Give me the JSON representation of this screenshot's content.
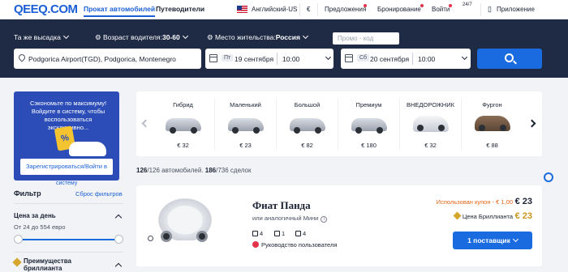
{
  "header": {
    "logo": "QEEQ.COM",
    "tab_active": "Прокат автомобилей",
    "tab_other": "Путеводители",
    "language": "Английский-US",
    "currency": "€",
    "offers": "Предложения",
    "bookings": "Бронирование",
    "login": "Войти",
    "support_label": "24/7",
    "app": "Приложение"
  },
  "search": {
    "same_dropoff": "Та же высадка",
    "driver_age_label": "Возраст водителя:",
    "driver_age_value": "30-60",
    "residence_label": "Место жительства:",
    "residence_value": "Россия",
    "promo_placeholder": "Промо - код",
    "location": "Podgorica Airport(TGD), Podgorica, Montenegro",
    "pickup_day": "Пт",
    "pickup_date": "19 сентября",
    "pickup_time": "10:00",
    "return_day": "Сб",
    "return_date": "20 сентября",
    "return_time": "10:00"
  },
  "promo_card": {
    "text": "Сэкономьте по максимуму! Войдите в систему, чтобы воспользоваться эксклюзивно...",
    "tag": "%",
    "register_button": "Зарегистрироваться/Войти в",
    "register_tail": "систему"
  },
  "categories": [
    {
      "name": "Гибрид",
      "price": "€ 32"
    },
    {
      "name": "Маленький",
      "price": "€ 23"
    },
    {
      "name": "Большой",
      "price": "€ 82"
    },
    {
      "name": "Премиум",
      "price": "€ 180"
    },
    {
      "name": "ВНЕДОРОЖНИК",
      "price": "€ 32"
    },
    {
      "name": "Фургон",
      "price": "€ 88"
    }
  ],
  "counts": {
    "cars_bold": "126",
    "cars_rest": "/126 автомобилей.",
    "deals_bold": "186",
    "deals_rest": "/736 сделок"
  },
  "filters": {
    "title": "Фильтр",
    "reset": "Сброс фильтров",
    "price_title": "Цена за день",
    "price_range": "От 24 до 554 евро",
    "perk_title_1": "Преимущества",
    "perk_title_2": "бриллианта"
  },
  "result": {
    "name": "Фиат Панда",
    "similar": "или аналогичный Мини",
    "seats": "4",
    "bags": "1",
    "doors": "4",
    "guide": "Руководство пользователя",
    "coupon": "Использован купон - € 1,00",
    "price": "€ 23",
    "diamond_label": "Цена Бриллианта",
    "diamond_price": "€ 23",
    "suppliers_button": "1 поставщик"
  },
  "colors": {
    "primary": "#1b6be0",
    "dark_bar": "#1f2a44",
    "coupon": "#e36414",
    "gold": "#c8961e"
  }
}
